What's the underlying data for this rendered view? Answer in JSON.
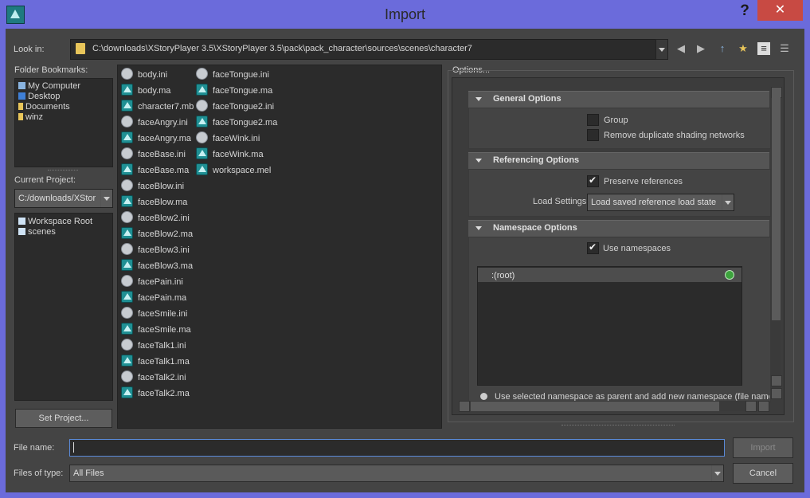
{
  "window": {
    "title": "Import",
    "help_label": "?",
    "close_label": "✕"
  },
  "look_in": {
    "label": "Look in:",
    "path": "C:\\downloads\\XStoryPlayer 3.5\\XStoryPlayer 3.5\\pack\\pack_character\\sources\\scenes\\character7"
  },
  "nav": {
    "back": "◀",
    "forward": "▶",
    "up": "↑",
    "new_folder": "★",
    "list_view": "≡",
    "detail_view": "☰"
  },
  "bookmarks": {
    "label": "Folder Bookmarks:",
    "items": [
      {
        "label": "My Computer",
        "color": "#8ab4e0"
      },
      {
        "label": "Desktop",
        "color": "#3f7fd6"
      },
      {
        "label": "Documents",
        "color": "#e8c55a"
      },
      {
        "label": "winz",
        "color": "#e8c55a"
      }
    ]
  },
  "project": {
    "label": "Current Project:",
    "value": "C:/downloads/XStor",
    "items": [
      {
        "label": "Workspace Root"
      },
      {
        "label": "scenes"
      }
    ],
    "set_button": "Set Project..."
  },
  "files": {
    "col1": [
      {
        "name": "body.ini",
        "type": "ini"
      },
      {
        "name": "body.ma",
        "type": "ma"
      },
      {
        "name": "character7.mb",
        "type": "mb"
      },
      {
        "name": "faceAngry.ini",
        "type": "ini"
      },
      {
        "name": "faceAngry.ma",
        "type": "ma"
      },
      {
        "name": "faceBase.ini",
        "type": "ini"
      },
      {
        "name": "faceBase.ma",
        "type": "ma"
      },
      {
        "name": "faceBlow.ini",
        "type": "ini"
      },
      {
        "name": "faceBlow.ma",
        "type": "ma"
      },
      {
        "name": "faceBlow2.ini",
        "type": "ini"
      },
      {
        "name": "faceBlow2.ma",
        "type": "ma"
      },
      {
        "name": "faceBlow3.ini",
        "type": "ini"
      },
      {
        "name": "faceBlow3.ma",
        "type": "ma"
      },
      {
        "name": "facePain.ini",
        "type": "ini"
      },
      {
        "name": "facePain.ma",
        "type": "ma"
      },
      {
        "name": "faceSmile.ini",
        "type": "ini"
      },
      {
        "name": "faceSmile.ma",
        "type": "ma"
      },
      {
        "name": "faceTalk1.ini",
        "type": "ini"
      },
      {
        "name": "faceTalk1.ma",
        "type": "ma"
      },
      {
        "name": "faceTalk2.ini",
        "type": "ini"
      },
      {
        "name": "faceTalk2.ma",
        "type": "ma"
      }
    ],
    "col2": [
      {
        "name": "faceTongue.ini",
        "type": "ini"
      },
      {
        "name": "faceTongue.ma",
        "type": "ma"
      },
      {
        "name": "faceTongue2.ini",
        "type": "ini"
      },
      {
        "name": "faceTongue2.ma",
        "type": "ma"
      },
      {
        "name": "faceWink.ini",
        "type": "ini"
      },
      {
        "name": "faceWink.ma",
        "type": "ma"
      },
      {
        "name": "workspace.mel",
        "type": "mel"
      }
    ]
  },
  "options": {
    "label": "Options...",
    "general": {
      "title": "General Options",
      "group": "Group",
      "remove_dup": "Remove duplicate shading networks"
    },
    "referencing": {
      "title": "Referencing Options",
      "preserve": "Preserve references",
      "load_settings_label": "Load Settings",
      "load_settings_value": "Load saved reference load state"
    },
    "namespace": {
      "title": "Namespace Options",
      "use_ns": "Use namespaces",
      "root": ":(root)",
      "use_selected": "Use selected namespace as parent and add new namespace (file name)"
    }
  },
  "file_name": {
    "label": "File name:",
    "value": ""
  },
  "files_of_type": {
    "label": "Files of type:",
    "value": "All Files"
  },
  "buttons": {
    "import": "Import",
    "cancel": "Cancel"
  }
}
